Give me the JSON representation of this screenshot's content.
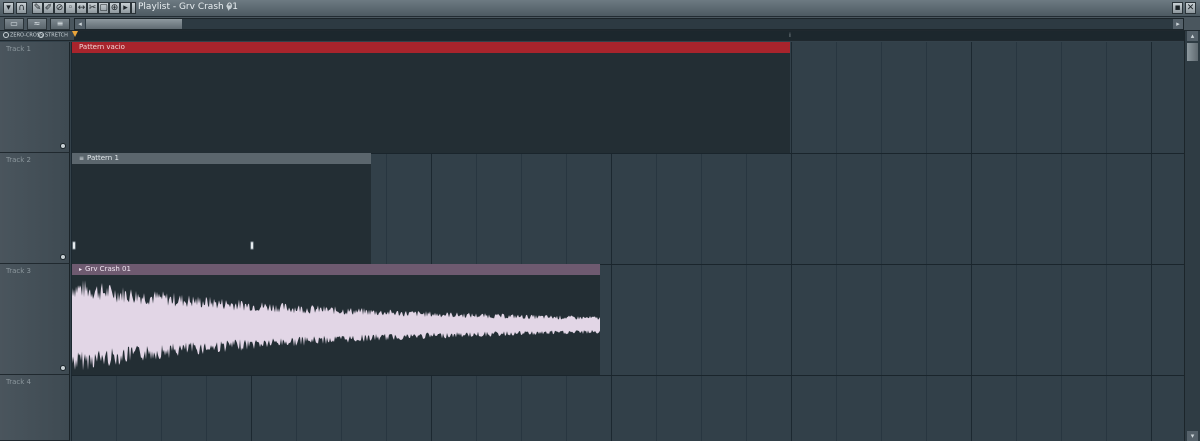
{
  "window": {
    "title": "Playlist - Grv Crash 01"
  },
  "toolbar": {
    "tab_labels": [
      "▭",
      "≈",
      "≡"
    ]
  },
  "options": {
    "zero_cross_label": "ZERO-CROSS",
    "stretch_label": "STRETCH"
  },
  "tracks": [
    {
      "name": "Track 1"
    },
    {
      "name": "Track 2"
    },
    {
      "name": "Track 3"
    },
    {
      "name": "Track 4"
    }
  ],
  "clips": [
    {
      "label": "Pattern vacio",
      "type": "pattern",
      "color": "#a8242c"
    },
    {
      "label": "Pattern 1",
      "type": "pattern",
      "color": "#5b666d"
    },
    {
      "label": "Grv Crash 01",
      "type": "audio",
      "color": "#6e5a70"
    }
  ],
  "icons": {
    "window": [
      "menu-icon",
      "snap-icon",
      "pencil-icon",
      "paint-icon",
      "delete-icon",
      "mute-icon",
      "slip-icon",
      "slice-icon",
      "select-icon",
      "zoom-icon",
      "play-icon"
    ],
    "window_right": [
      "detach-icon",
      "close-icon"
    ]
  }
}
